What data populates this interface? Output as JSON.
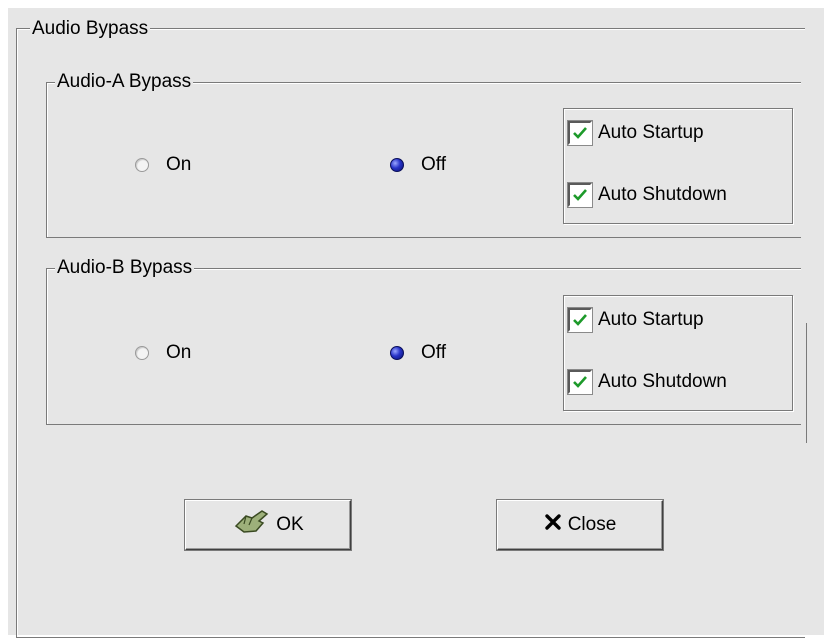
{
  "dialog": {
    "title": "Audio Bypass"
  },
  "groups": [
    {
      "label": "Audio-A Bypass",
      "radio_on_label": "On",
      "radio_off_label": "Off",
      "selected": "Off",
      "auto_startup_label": "Auto Startup",
      "auto_startup_checked": true,
      "auto_shutdown_label": "Auto Shutdown",
      "auto_shutdown_checked": true
    },
    {
      "label": "Audio-B Bypass",
      "radio_on_label": "On",
      "radio_off_label": "Off",
      "selected": "Off",
      "auto_startup_label": "Auto Startup",
      "auto_startup_checked": true,
      "auto_shutdown_label": "Auto Shutdown",
      "auto_shutdown_checked": true
    }
  ],
  "buttons": {
    "ok_label": "OK",
    "ok_icon": "hand-ok-icon",
    "close_label": "Close",
    "close_icon": "x-close-icon"
  },
  "colors": {
    "panel_bg": "#e6e6e6",
    "radio_selected": "#2733c8",
    "check_mark": "#1d9a2a"
  }
}
